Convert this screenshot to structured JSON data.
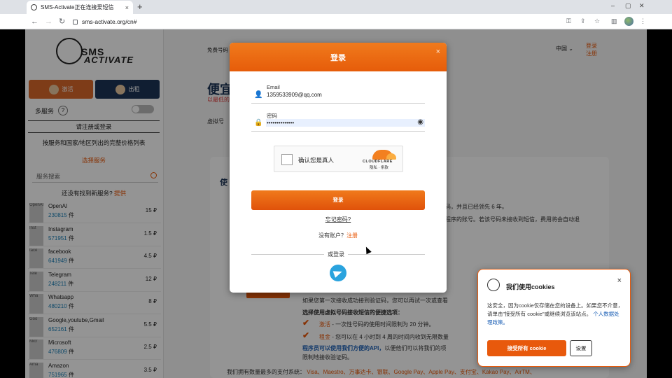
{
  "browser": {
    "tab_title": "SMS-Activate正在连接爱短信",
    "tab_close": "×",
    "new_tab": "+",
    "url": "sms-activate.org/cn#"
  },
  "sidebar": {
    "logo_line1": "SMS",
    "logo_line2": "ACTIVATE",
    "activate_label": "激活",
    "rent_label": "出租",
    "multi_service": "多服务",
    "help_q": "?",
    "register_prompt": "请注册或登录",
    "price_list": "按服务和国家/地区列出的完整价格列表",
    "choose_service": "选择服务",
    "search_placeholder": "服务搜索",
    "not_found": "还没有找到新服务?",
    "suggest": "提供",
    "services": [
      {
        "name": "OpenAI",
        "count": "230815",
        "unit": "件",
        "price": "15 ₽",
        "icon": "OpenAI"
      },
      {
        "name": "Instagram",
        "count": "571951",
        "unit": "件",
        "price": "1.5 ₽",
        "icon": "Inst"
      },
      {
        "name": "facebook",
        "count": "641949",
        "unit": "件",
        "price": "4.5 ₽",
        "icon": "face"
      },
      {
        "name": "Telegram",
        "count": "248211",
        "unit": "件",
        "price": "12 ₽",
        "icon": "Tele"
      },
      {
        "name": "Whatsapp",
        "count": "480210",
        "unit": "件",
        "price": "8 ₽",
        "icon": "Wha"
      },
      {
        "name": "Google,youtube,Gmail",
        "count": "652161",
        "unit": "件",
        "price": "5.5 ₽",
        "icon": "Goo"
      },
      {
        "name": "Microsoft",
        "count": "476809",
        "unit": "件",
        "price": "2.5 ₽",
        "icon": "Micr"
      },
      {
        "name": "Amazon",
        "count": "751965",
        "unit": "件",
        "price": "3.5 ₽",
        "icon": "Ama"
      }
    ]
  },
  "main": {
    "topnav": "免费号码",
    "language": "中国 ⌄",
    "login": "登录",
    "register": "注册",
    "heading": "便宜",
    "subheading": "以最低的",
    "img_alt": "虚拟号",
    "card_title": "使",
    "line_a": "码，并且已经领先 6 年。",
    "line_b": "程序的账号。若该号码未接收到短信，费用将会自动退",
    "first_time": "如果您第一次接收成功接到验证码，您可以再试一次或查看",
    "choose_line": "选择使用虚拟号码接收短信的便捷选项：",
    "activation_label": "激活",
    "activation_text": " - 一次性号码的使用时间限制为 20 分钟。",
    "rent_label": "租金",
    "rent_text": " - 您可以在 4 小时到 4 周的时间内收到无限数量",
    "api_line": "程序员可以使用我们方便的API，",
    "api_rest": "以便他们可以将我们的项",
    "limit_line": "限制地接收验证码。",
    "payments_prefix": "我们拥有数量最多的支付系统：",
    "payments": "Visa、Maestro、万事达卡、银联、Google Pay、Apple Pay、支付宝、Kakao Pay、AirTM、"
  },
  "modal": {
    "title": "登录",
    "close": "×",
    "email_label": "Email",
    "email_value": "1359533909@qq.com",
    "password_label": "密码",
    "password_value": "••••••••••••••",
    "captcha_text": "确认您是真人",
    "cf_brand": "CLOUDFLARE",
    "cf_links": "隐私 · 条款",
    "login_button": "登录",
    "forgot": "忘记密码?",
    "no_account": "没有账户？",
    "register": "注册",
    "or_login": "或登录"
  },
  "cookie": {
    "title": "我们使用cookies",
    "close": "×",
    "text": "这安全，因为cookie仅存储在您的设备上。如果您不介意，请单击\"接受所有 cookie\"或继续浏览该站点。",
    "policy": "个人数据处理政策。",
    "accept": "接受所有 cookie",
    "settings": "设置"
  },
  "colors": {
    "brand_orange": "#e8590c",
    "activate_btn": "#d9682a",
    "rent_btn": "#1d3557"
  }
}
